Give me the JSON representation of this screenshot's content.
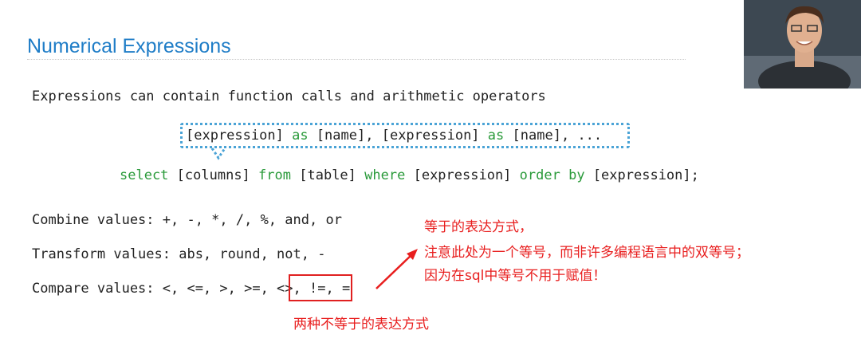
{
  "slide": {
    "title": "Numerical Expressions",
    "intro": "Expressions can contain function calls and arithmetic operators",
    "callout": {
      "parts": [
        "[expression]",
        "as",
        "[name],",
        "[expression]",
        "as",
        "[name],",
        "..."
      ]
    },
    "select_line": {
      "parts": [
        "select",
        "[columns]",
        "from",
        "[table]",
        "where",
        "[expression]",
        "order by",
        "[expression];"
      ]
    },
    "combine": "Combine values: +, -, *, /, %, and, or",
    "transform": "Transform values: abs, round, not, -",
    "compare": {
      "prefix": "Compare values: <, <=, >, >=, ",
      "highlighted": "<>, !=,",
      "suffix": " ="
    }
  },
  "annotations": {
    "note_right": [
      "等于的表达方式，",
      "注意此处为一个等号，而非许多编程语言中的双等号；",
      "因为在sql中等号不用于赋值！"
    ],
    "note_below": "两种不等于的表达方式"
  },
  "colors": {
    "title": "#1f7dc7",
    "keyword": "#2a9a3a",
    "annotation": "#e81e1e",
    "callout_border": "#4aa3d6"
  },
  "icons": {
    "webcam": "presenter-webcam"
  }
}
